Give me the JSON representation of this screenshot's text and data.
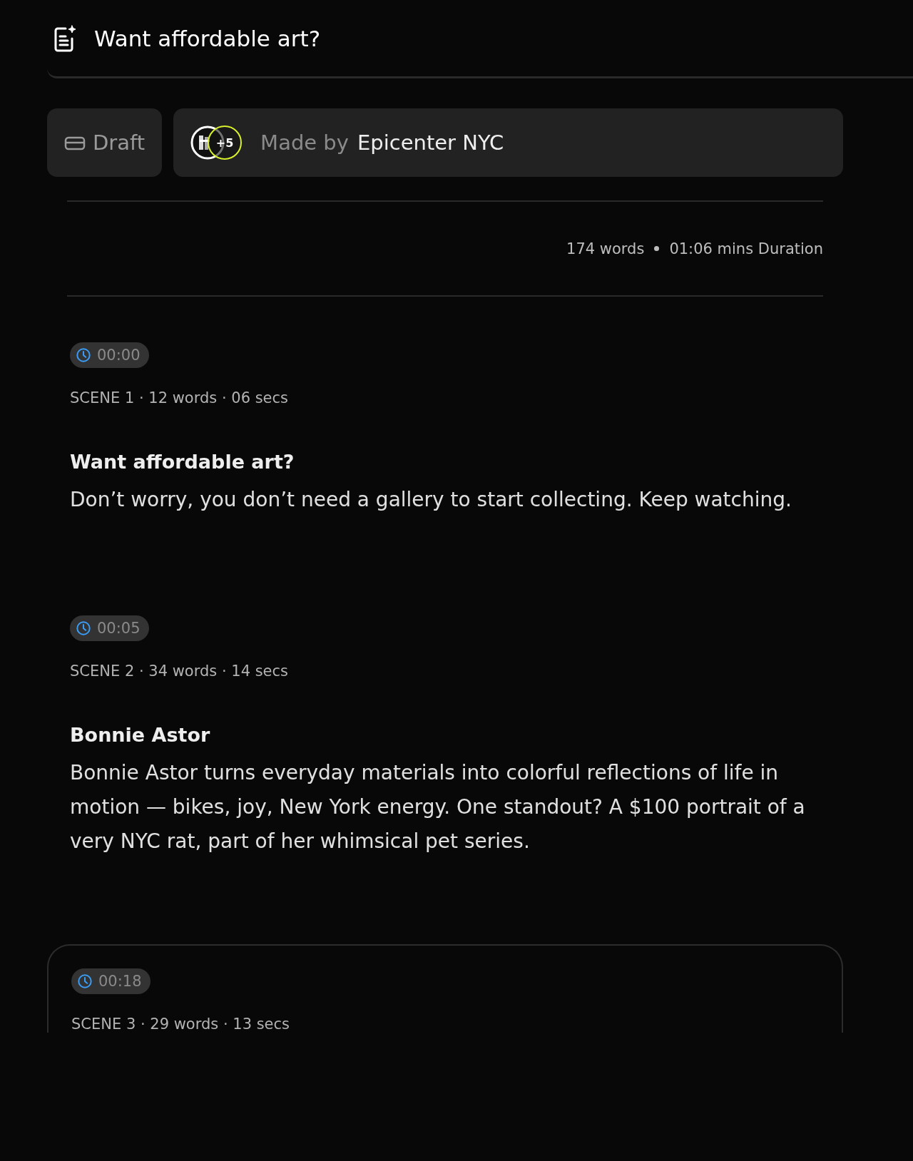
{
  "header": {
    "title": "Want affordable art?"
  },
  "info_bar": {
    "status": "Draft",
    "avatar_more": "+5",
    "made_by_label": "Made by",
    "made_by_name": "Epicenter NYC"
  },
  "stats": {
    "words": "174 words",
    "duration": "01:06 mins Duration"
  },
  "scenes": [
    {
      "timestamp": "00:00",
      "meta": "SCENE 1 · 12 words · 06 secs",
      "title": "Want affordable art?",
      "text": "Don’t worry, you don’t need a gallery to start collecting. Keep watching.",
      "selected": false
    },
    {
      "timestamp": "00:05",
      "meta": "SCENE 2 · 34 words · 14 secs",
      "title": "Bonnie Astor",
      "text": "Bonnie Astor turns everyday materials into colorful reflections of life in motion — bikes, joy, New York energy. One standout? A $100 portrait of a very NYC rat, part of her whimsical pet series.",
      "selected": false
    },
    {
      "timestamp": "00:18",
      "meta": "SCENE 3 · 29 words · 13 secs",
      "selected": true
    }
  ]
}
